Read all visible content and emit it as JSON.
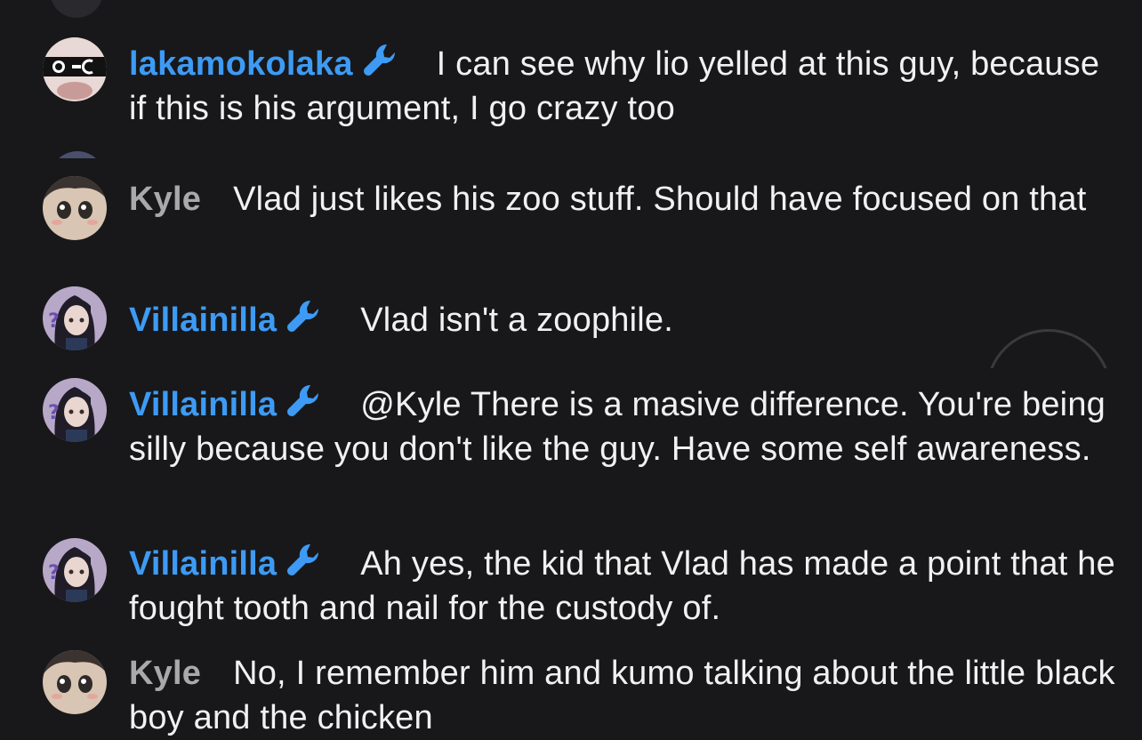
{
  "messages": [
    {
      "author": "lakamokolaka",
      "author_color": "#3d9bf5",
      "badge": "wrench-icon",
      "text": "I can see why lio yelled at this guy, because if this is his argument, I go crazy too"
    },
    {
      "author": "Kyle",
      "author_color": "#a9a9ab",
      "badge": null,
      "text": "Vlad just likes his zoo stuff. Should have focused on that"
    },
    {
      "author": "Villainilla",
      "author_color": "#3d9bf5",
      "badge": "wrench-icon",
      "text": "Vlad isn't a zoophile."
    },
    {
      "author": "Villainilla",
      "author_color": "#3d9bf5",
      "badge": "wrench-icon",
      "text": "@Kyle There is a masive difference. You're being silly because you don't like the guy. Have some self awareness."
    },
    {
      "author": "Villainilla",
      "author_color": "#3d9bf5",
      "badge": "wrench-icon",
      "text": "Ah yes, the kid that Vlad has made a point that he fought tooth and nail for the custody of."
    },
    {
      "author": "Kyle",
      "author_color": "#a9a9ab",
      "badge": null,
      "text": "No, I remember him and kumo talking about the little black boy and the chicken"
    }
  ],
  "colors": {
    "background": "#18181a",
    "moderator_name": "#3d9bf5",
    "viewer_name": "#a9a9ab",
    "message_text": "#f1f1f1"
  }
}
